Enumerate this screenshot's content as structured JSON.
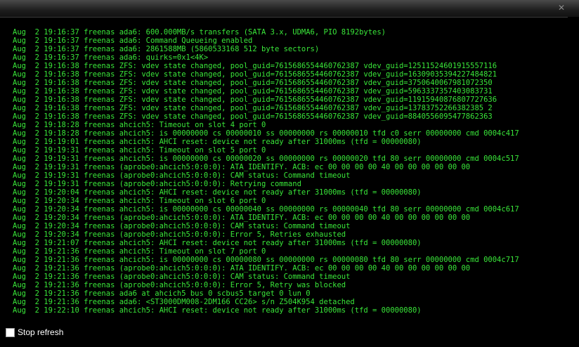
{
  "window": {
    "close_glyph": "✕"
  },
  "log": {
    "lines": [
      "Aug  2 19:16:37 freenas ada6: 600.000MB/s transfers (SATA 3.x, UDMA6, PIO 8192bytes)",
      "Aug  2 19:16:37 freenas ada6: Command Queueing enabled",
      "Aug  2 19:16:37 freenas ada6: 2861588MB (5860533168 512 byte sectors)",
      "Aug  2 19:16:37 freenas ada6: quirks=0x1<4K>",
      "Aug  2 19:16:38 freenas ZFS: vdev state changed, pool_guid=7615686554460762387 vdev_guid=12511524601915557116",
      "Aug  2 19:16:38 freenas ZFS: vdev state changed, pool_guid=7615686554460762387 vdev_guid=16309035394227484821",
      "Aug  2 19:16:38 freenas ZFS: vdev state changed, pool_guid=7615686554460762387 vdev_guid=3750640067981072350",
      "Aug  2 19:16:38 freenas ZFS: vdev state changed, pool_guid=7615686554460762387 vdev_guid=5963337357403083731",
      "Aug  2 19:16:38 freenas ZFS: vdev state changed, pool_guid=7615686554460762387 vdev_guid=11915940876807727636",
      "Aug  2 19:16:38 freenas ZFS: vdev state changed, pool_guid=7615686554460762387 vdev_guid=13783752266382385 2",
      "Aug  2 19:16:38 freenas ZFS: vdev state changed, pool_guid=7615686554460762387 vdev_guid=8840556095477862363",
      "Aug  2 19:18:28 freenas ahcich5: Timeout on slot 4 port 0",
      "Aug  2 19:18:28 freenas ahcich5: is 00000000 cs 00000010 ss 00000000 rs 00000010 tfd c0 serr 00000000 cmd 0004c417",
      "Aug  2 19:19:01 freenas ahcich5: AHCI reset: device not ready after 31000ms (tfd = 00000080)",
      "Aug  2 19:19:31 freenas ahcich5: Timeout on slot 5 port 0",
      "Aug  2 19:19:31 freenas ahcich5: is 00000000 cs 00000020 ss 00000000 rs 00000020 tfd 80 serr 00000000 cmd 0004c517",
      "Aug  2 19:19:31 freenas (aprobe0:ahcich5:0:0:0): ATA_IDENTIFY. ACB: ec 00 00 00 00 40 00 00 00 00 00 00",
      "Aug  2 19:19:31 freenas (aprobe0:ahcich5:0:0:0): CAM status: Command timeout",
      "Aug  2 19:19:31 freenas (aprobe0:ahcich5:0:0:0): Retrying command",
      "Aug  2 19:20:04 freenas ahcich5: AHCI reset: device not ready after 31000ms (tfd = 00000080)",
      "Aug  2 19:20:34 freenas ahcich5: Timeout on slot 6 port 0",
      "Aug  2 19:20:34 freenas ahcich5: is 00000000 cs 00000040 ss 00000000 rs 00000040 tfd 80 serr 00000000 cmd 0004c617",
      "Aug  2 19:20:34 freenas (aprobe0:ahcich5:0:0:0): ATA_IDENTIFY. ACB: ec 00 00 00 00 40 00 00 00 00 00 00",
      "Aug  2 19:20:34 freenas (aprobe0:ahcich5:0:0:0): CAM status: Command timeout",
      "Aug  2 19:20:34 freenas (aprobe0:ahcich5:0:0:0): Error 5, Retries exhausted",
      "Aug  2 19:21:07 freenas ahcich5: AHCI reset: device not ready after 31000ms (tfd = 00000080)",
      "Aug  2 19:21:36 freenas ahcich5: Timeout on slot 7 port 0",
      "Aug  2 19:21:36 freenas ahcich5: is 00000000 cs 00000080 ss 00000000 rs 00000080 tfd 80 serr 00000000 cmd 0004c717",
      "Aug  2 19:21:36 freenas (aprobe0:ahcich5:0:0:0): ATA_IDENTIFY. ACB: ec 00 00 00 00 40 00 00 00 00 00 00",
      "Aug  2 19:21:36 freenas (aprobe0:ahcich5:0:0:0): CAM status: Command timeout",
      "Aug  2 19:21:36 freenas (aprobe0:ahcich5:0:0:0): Error 5, Retry was blocked",
      "Aug  2 19:21:36 freenas ada6 at ahcich5 bus 0 scbus5 target 0 lun 0",
      "Aug  2 19:21:36 freenas ada6: <ST3000DM008-2DM166 CC26> s/n Z504K954 detached",
      "Aug  2 19:22:10 freenas ahcich5: AHCI reset: device not ready after 31000ms (tfd = 00000080)"
    ]
  },
  "footer": {
    "stop_refresh_label": "Stop refresh",
    "stop_refresh_checked": false
  },
  "colors": {
    "log_text": "#39e639",
    "background": "#000000"
  }
}
